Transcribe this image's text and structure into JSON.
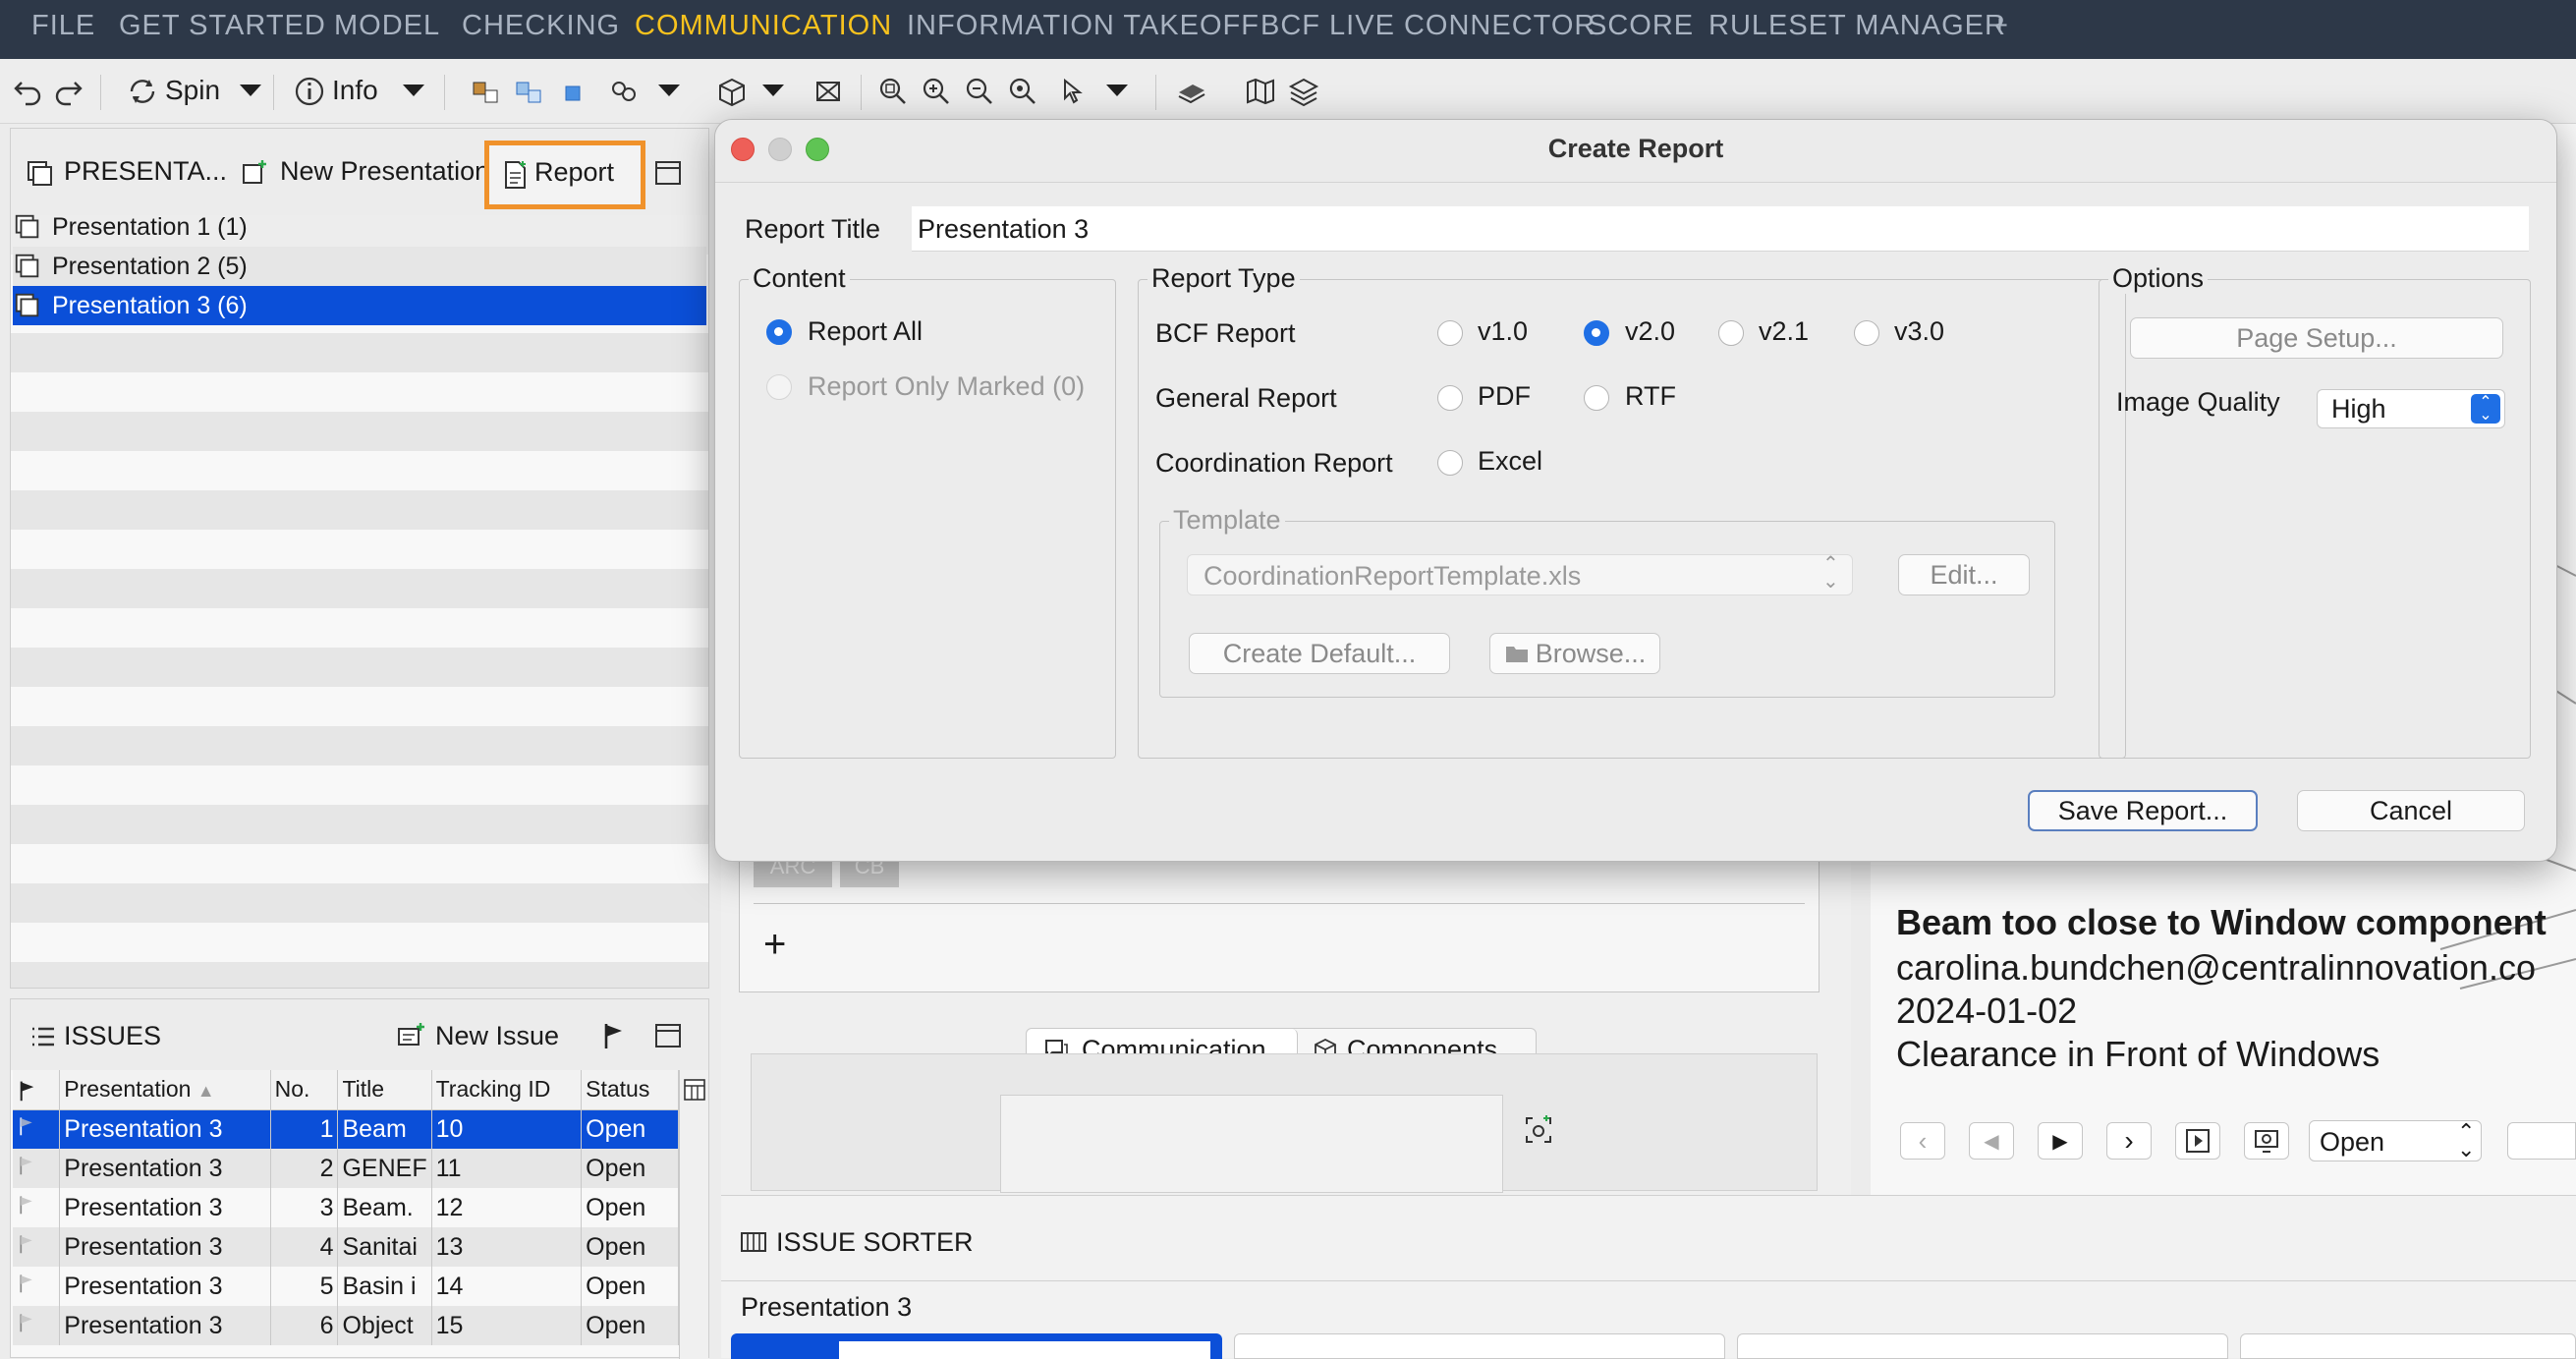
{
  "menu": [
    "FILE",
    "GET STARTED",
    "MODEL",
    "CHECKING",
    "COMMUNICATION",
    "INFORMATION TAKEOFF",
    "BCF LIVE CONNECTOR",
    "SCORE",
    "RULESET MANAGER",
    "+"
  ],
  "toolbar": {
    "spin": "Spin",
    "info": "Info"
  },
  "presentations": {
    "title": "PRESENTA...",
    "new_button": "New Presentation",
    "report_button": "Report",
    "items": [
      "Presentation 1 (1)",
      "Presentation 2 (5)",
      "Presentation 3 (6)"
    ]
  },
  "issues": {
    "title": "ISSUES",
    "new_button": "New Issue",
    "columns": [
      "Presentation",
      "No.",
      "Title",
      "Tracking ID",
      "Status"
    ],
    "rows": [
      [
        "Presentation 3",
        "1",
        "Beam",
        "10",
        "Open"
      ],
      [
        "Presentation 3",
        "2",
        "GENEF",
        "11",
        "Open"
      ],
      [
        "Presentation 3",
        "3",
        "Beam.",
        "12",
        "Open"
      ],
      [
        "Presentation 3",
        "4",
        "Sanitai",
        "13",
        "Open"
      ],
      [
        "Presentation 3",
        "5",
        "Basin i",
        "14",
        "Open"
      ],
      [
        "Presentation 3",
        "6",
        "Object",
        "15",
        "Open"
      ]
    ]
  },
  "center": {
    "tabs": [
      "Communication",
      "Components"
    ],
    "chips": [
      "ARC",
      "CB"
    ],
    "plus": "+"
  },
  "issue_detail": {
    "title": "Beam too close to Window component",
    "email": "carolina.bundchen@centralinnovation.co",
    "date": "2024-01-02",
    "rule": "Clearance in Front of Windows",
    "status_select": "Open"
  },
  "sorter": {
    "title": "ISSUE SORTER",
    "presentation": "Presentation 3"
  },
  "dialog": {
    "title": "Create Report",
    "report_title_label": "Report Title",
    "report_title_value": "Presentation 3",
    "content_legend": "Content",
    "report_all": "Report All",
    "report_marked": "Report Only Marked (0)",
    "type_legend": "Report Type",
    "bcf_label": "BCF Report",
    "bcf_options": [
      "v1.0",
      "v2.0",
      "v2.1",
      "v3.0"
    ],
    "general_label": "General Report",
    "general_options": [
      "PDF",
      "RTF"
    ],
    "coord_label": "Coordination Report",
    "coord_options": [
      "Excel"
    ],
    "template_legend": "Template",
    "template_value": "CoordinationReportTemplate.xls",
    "edit_button": "Edit...",
    "create_default_button": "Create Default...",
    "browse_button": "Browse...",
    "options_legend": "Options",
    "page_setup_button": "Page Setup...",
    "image_quality_label": "Image Quality",
    "image_quality_value": "High",
    "save_button": "Save Report...",
    "cancel_button": "Cancel"
  },
  "colors": {
    "menubar": "#2d3848",
    "active_menu": "#f7c21e",
    "selection": "#0b4fd8",
    "highlight": "#f0922b"
  }
}
